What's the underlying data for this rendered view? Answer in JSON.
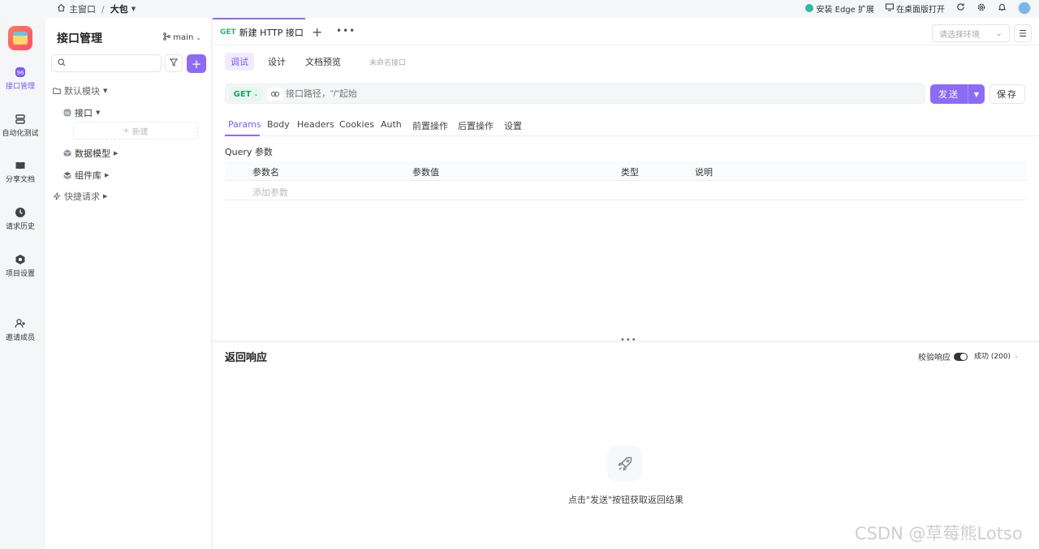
{
  "breadcrumb": {
    "home": "主窗口",
    "separator": "/",
    "current": "大包"
  },
  "topbar": {
    "edge": "安装 Edge 扩展",
    "desktop": "在桌面版打开"
  },
  "rail": {
    "items": [
      {
        "label": "接口管理"
      },
      {
        "label": "自动化测试"
      },
      {
        "label": "分享文档"
      },
      {
        "label": "请求历史"
      },
      {
        "label": "项目设置"
      },
      {
        "label": "邀请成员"
      }
    ]
  },
  "sidebar": {
    "title": "接口管理",
    "branch": "main",
    "search_placeholder": "",
    "tree": {
      "default_module": "默认模块",
      "api": "接口",
      "new": "新建",
      "data_model": "数据模型",
      "components": "组件库",
      "quick_request": "快捷请求"
    }
  },
  "tab": {
    "method": "GET",
    "title": "新建 HTTP 接口"
  },
  "env": {
    "placeholder": "请选择环境"
  },
  "modes": {
    "debug": "调试",
    "design": "设计",
    "preview": "文档预览",
    "name": "未命名接口"
  },
  "request": {
    "method": "GET",
    "url_placeholder": "接口路径，\"/\"起始",
    "url_value": "",
    "send": "发送",
    "save": "保存"
  },
  "subtabs": [
    "Params",
    "Body",
    "Headers",
    "Cookies",
    "Auth",
    "前置操作",
    "后置操作",
    "设置"
  ],
  "params": {
    "section": "Query 参数",
    "headers": {
      "name": "参数名",
      "value": "参数值",
      "type": "类型",
      "desc": "说明"
    },
    "add": "添加参数"
  },
  "response": {
    "title": "返回响应",
    "verify": "校验响应",
    "verify_enabled": true,
    "status": "成功 (200)",
    "empty": "点击\"发送\"按钮获取返回结果"
  },
  "watermark": "CSDN @草莓熊Lotso",
  "colors": {
    "accent": "#8c6cf5",
    "get": "#1fa463",
    "text": "#333333"
  }
}
